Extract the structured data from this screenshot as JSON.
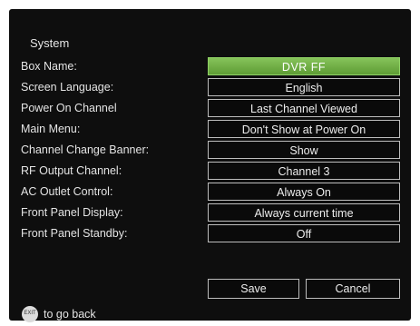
{
  "title": "System",
  "settings": [
    {
      "label": "Box Name:",
      "value": "DVR  FF",
      "selected": true
    },
    {
      "label": "Screen Language:",
      "value": "English"
    },
    {
      "label": "Power On Channel",
      "value": "Last Channel Viewed"
    },
    {
      "label": "Main Menu:",
      "value": "Don't Show at Power On"
    },
    {
      "label": "Channel Change Banner:",
      "value": "Show"
    },
    {
      "label": "RF Output Channel:",
      "value": "Channel 3"
    },
    {
      "label": "AC Outlet Control:",
      "value": "Always On"
    },
    {
      "label": "Front Panel Display:",
      "value": "Always current time"
    },
    {
      "label": "Front Panel Standby:",
      "value": "Off"
    }
  ],
  "buttons": {
    "save": "Save",
    "cancel": "Cancel"
  },
  "footer": {
    "back_key": "EXIT",
    "back_text": "to go back"
  },
  "colors": {
    "background": "#0e0e0e",
    "selected": "#6fb043"
  }
}
